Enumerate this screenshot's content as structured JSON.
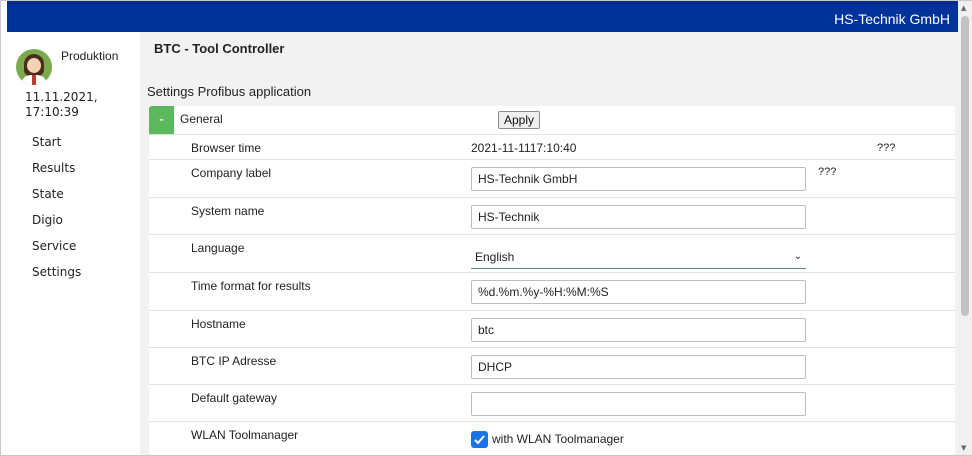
{
  "header": {
    "brand": "HS-Technik GmbH"
  },
  "sidebar": {
    "user_name": "Produktion",
    "datetime_line1": "11.11.2021,",
    "datetime_line2": "17:10:39",
    "items": [
      {
        "label": "Start"
      },
      {
        "label": "Results"
      },
      {
        "label": "State"
      },
      {
        "label": "Digio"
      },
      {
        "label": "Service"
      },
      {
        "label": "Settings"
      }
    ]
  },
  "main": {
    "app_title": "BTC - Tool Controller",
    "section_title": "Settings Profibus application",
    "group": {
      "toggle": "-",
      "label": "General",
      "apply_label": "Apply"
    },
    "browser_time": {
      "label": "Browser time",
      "value": "2021-11-1117:10:40",
      "extra": "???"
    },
    "company_label": {
      "label": "Company label",
      "value": "HS-Technik GmbH",
      "extra": "???"
    },
    "system_name": {
      "label": "System name",
      "value": "HS-Technik"
    },
    "language": {
      "label": "Language",
      "value": "English"
    },
    "time_format": {
      "label": "Time format for results",
      "value": "%d.%m.%y-%H:%M:%S"
    },
    "hostname": {
      "label": "Hostname",
      "value": "btc"
    },
    "ip_address": {
      "label": "BTC IP Adresse",
      "value": "DHCP"
    },
    "default_gateway": {
      "label": "Default gateway",
      "value": ""
    },
    "wlan": {
      "label": "WLAN Toolmanager",
      "checkbox_label": "with WLAN Toolmanager",
      "checked": true
    }
  },
  "colors": {
    "topbar": "#003399",
    "toggle": "#5cb85c",
    "checkbox": "#1a73e8"
  }
}
